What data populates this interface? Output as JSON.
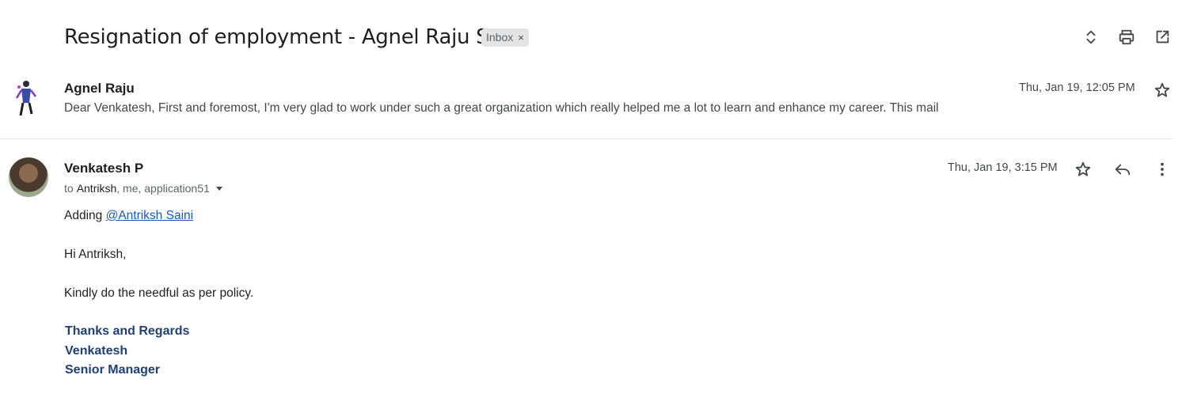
{
  "thread": {
    "subject": "Resignation of employment - Agnel Raju S",
    "label": "Inbox",
    "label_remove": "×"
  },
  "toolbar": {
    "icons": [
      "expand-collapse-icon",
      "print-icon",
      "open-in-new-window-icon"
    ]
  },
  "messages": [
    {
      "sender": "Agnel Raju",
      "date": "Thu, Jan 19, 12:05 PM",
      "snippet": "Dear Venkatesh, First and foremost, I'm very glad to work under such a great organization which really helped me a lot to learn and enhance my career. This mail",
      "starred": false
    },
    {
      "sender": "Venkatesh P",
      "date": "Thu, Jan 19, 3:15 PM",
      "to_prefix": "to",
      "to_strong": "Antriksh",
      "to_rest": ", me, application51",
      "body": {
        "adding": "Adding ",
        "mention": "@Antriksh Saini",
        "greeting": "Hi Antriksh,",
        "line1": "Kindly do the needful as per policy.",
        "sig1": "Thanks and Regards",
        "sig2": "Venkatesh",
        "sig3": "Senior Manager"
      },
      "starred": false
    }
  ],
  "colors": {
    "link": "#1a56c9",
    "signature": "#1f3f78",
    "chip_bg": "#e4e4e4"
  }
}
